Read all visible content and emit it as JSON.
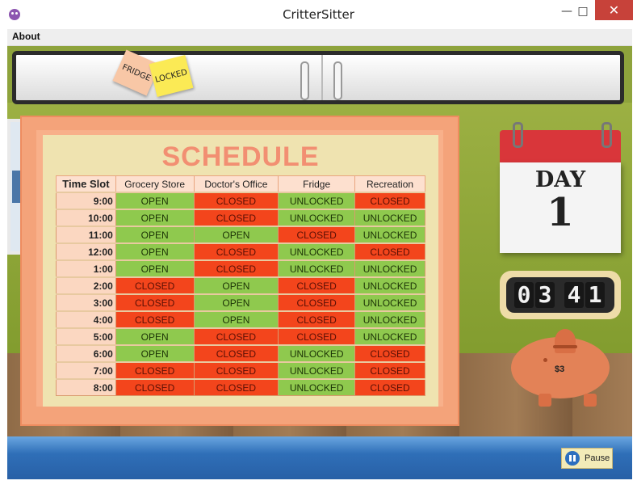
{
  "window": {
    "title": "CritterSitter"
  },
  "menu": {
    "about": "About"
  },
  "notes": {
    "fridge": "FRIDGE",
    "locked": "LOCKED"
  },
  "schedule": {
    "title": "SCHEDULE",
    "headers": [
      "Time Slot",
      "Grocery Store",
      "Doctor's Office",
      "Fridge",
      "Recreation"
    ],
    "rows": [
      [
        "9:00",
        "OPEN",
        "CLOSED",
        "UNLOCKED",
        "CLOSED"
      ],
      [
        "10:00",
        "OPEN",
        "CLOSED",
        "UNLOCKED",
        "UNLOCKED"
      ],
      [
        "11:00",
        "OPEN",
        "OPEN",
        "CLOSED",
        "UNLOCKED"
      ],
      [
        "12:00",
        "OPEN",
        "CLOSED",
        "UNLOCKED",
        "CLOSED"
      ],
      [
        "1:00",
        "OPEN",
        "CLOSED",
        "UNLOCKED",
        "UNLOCKED"
      ],
      [
        "2:00",
        "CLOSED",
        "OPEN",
        "CLOSED",
        "UNLOCKED"
      ],
      [
        "3:00",
        "CLOSED",
        "OPEN",
        "CLOSED",
        "UNLOCKED"
      ],
      [
        "4:00",
        "CLOSED",
        "OPEN",
        "CLOSED",
        "UNLOCKED"
      ],
      [
        "5:00",
        "OPEN",
        "CLOSED",
        "CLOSED",
        "UNLOCKED"
      ],
      [
        "6:00",
        "OPEN",
        "CLOSED",
        "UNLOCKED",
        "CLOSED"
      ],
      [
        "7:00",
        "CLOSED",
        "CLOSED",
        "UNLOCKED",
        "CLOSED"
      ],
      [
        "8:00",
        "CLOSED",
        "CLOSED",
        "UNLOCKED",
        "CLOSED"
      ]
    ]
  },
  "calendar": {
    "label": "DAY",
    "day": "1"
  },
  "clock": {
    "digits": [
      "0",
      "3",
      "4",
      "1"
    ]
  },
  "piggy": {
    "money": "$3"
  },
  "pause": {
    "label": "Pause"
  },
  "colors": {
    "open": "#8fc94e",
    "closed": "#f3451c",
    "board": "#f4a37a",
    "bottom_bar": "#2f6fb8"
  }
}
